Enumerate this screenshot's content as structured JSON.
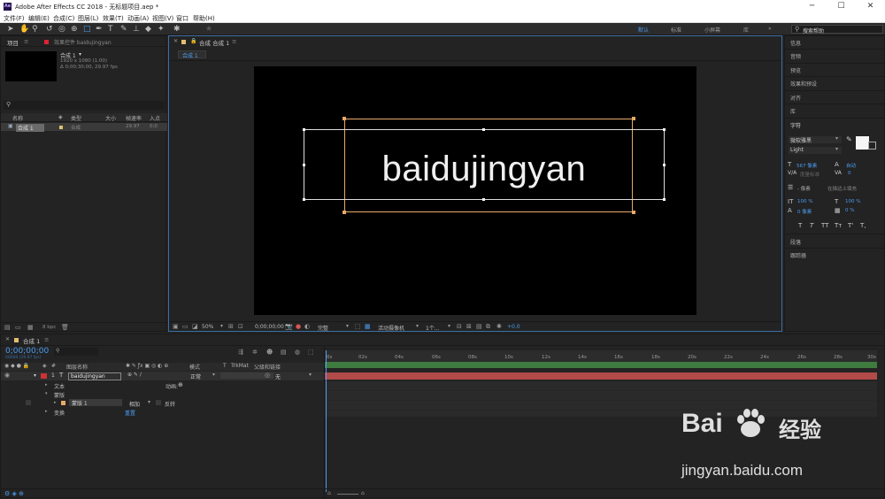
{
  "window": {
    "title": "Adobe After Effects CC 2018 - 无标题项目.aep *",
    "app_badge": "Ae",
    "min": "─",
    "max": "☐",
    "close": "✕"
  },
  "menu": [
    "文件(F)",
    "编辑(E)",
    "合成(C)",
    "图层(L)",
    "效果(T)",
    "动画(A)",
    "视图(V)",
    "窗口",
    "帮助(H)"
  ],
  "workspaces": {
    "default": "默认",
    "standard": "标准",
    "small": "小屏幕",
    "lib": "库",
    "more": "»"
  },
  "search": {
    "placeholder": "搜索帮助"
  },
  "project": {
    "tab": "项目",
    "tab_menu": "≡",
    "effect_tab": "效果控件 baidujingyan",
    "comp_name": "合成 1",
    "comp_info1": "1920 x 1080 (1.00)",
    "comp_info2": "Δ 0;00;30;00, 29.97 fps",
    "cols": {
      "name": "名称",
      "type": "类型",
      "size": "大小",
      "fps": "帧速率",
      "in": "入点"
    },
    "row": {
      "name": "合成 1",
      "type": "合成",
      "fps": "29.97",
      "in": "0;0"
    },
    "bpc": "8 bpc"
  },
  "comp": {
    "tab": "合成 合成 1",
    "tab_menu": "≡",
    "sub_tab": "合成 1",
    "text": "baidujingyan",
    "zoom": "50%",
    "time": "0;00;00;00",
    "res": "完整",
    "camera": "活动摄像机",
    "views": "1个...",
    "offset": "+0.0"
  },
  "right": {
    "items": [
      "信息",
      "音频",
      "预览",
      "效果和预设",
      "对齐",
      "库"
    ],
    "char_tab": "字符",
    "font": "微软雅黑",
    "style": "Light",
    "size": "567 像素",
    "leading": "自动",
    "kerning": "度量标准",
    "tracking": "0",
    "stroke": "- 像素",
    "stroke_opt": "在描边上填充",
    "vscale": "100 %",
    "hscale": "100 %",
    "baseline": "0 像素",
    "tsume": "0 %",
    "styles": [
      "T",
      "T",
      "TT",
      "Tт",
      "T'",
      "T,"
    ],
    "para": "段落",
    "tracker": "跟踪器"
  },
  "timeline": {
    "tab": "合成 1",
    "tab_menu": "≡",
    "timecode": "0;00;00;00",
    "frames": "00000 (29.97 fps)",
    "cols": {
      "layer_name": "图层名称",
      "mode": "模式",
      "t": "T",
      "trkmat": "TrkMat",
      "parent": "父级和链接"
    },
    "layer": {
      "num": "1",
      "name": "baidujingyan",
      "mode": "正常",
      "parent": "无"
    },
    "text_row": "文本",
    "animate": "动画:",
    "mask_group": "蒙版",
    "mask1": "蒙版 1",
    "mask_mode": "相加",
    "invert": "反转",
    "transform": "变换",
    "reset": "重置",
    "ticks": [
      "0s",
      "02s",
      "04s",
      "06s",
      "08s",
      "10s",
      "12s",
      "14s",
      "16s",
      "18s",
      "20s",
      "22s",
      "24s",
      "26s",
      "28s",
      "30s"
    ]
  },
  "watermark": {
    "brand": "Bai",
    "brand2": "经验",
    "url": "jingyan.baidu.com"
  }
}
